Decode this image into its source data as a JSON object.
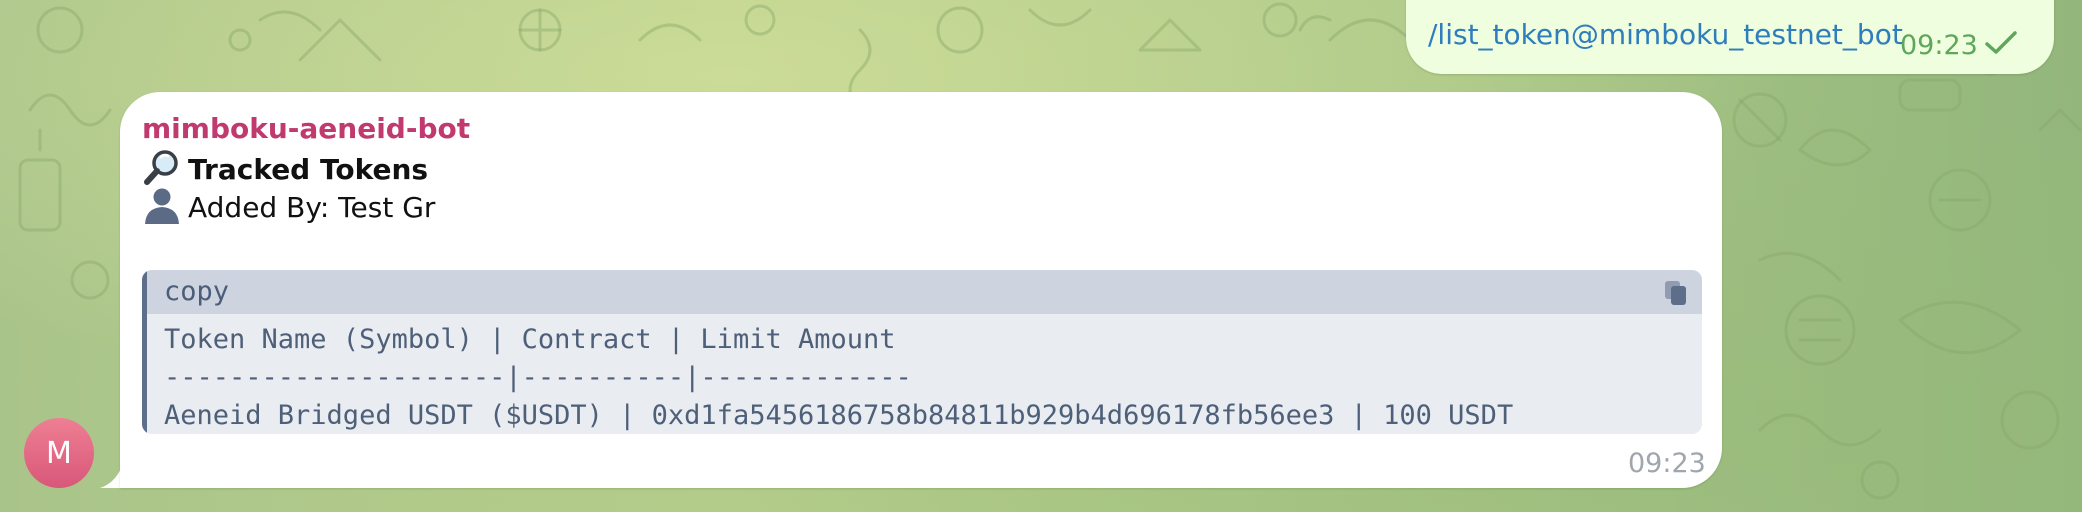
{
  "outgoing_message": {
    "text": "/list_token@mimboku_testnet_bot",
    "time": "09:23",
    "status_icon": "check-icon"
  },
  "incoming_message": {
    "sender": "mimboku-aeneid-bot",
    "title_icon": "magnifier-icon",
    "title": "Tracked Tokens",
    "added_by_icon": "user-silhouette-icon",
    "added_by": "Added By: Test Gr",
    "code_block": {
      "language": "copy",
      "copy_icon": "copy-icon",
      "lines": [
        "Token Name (Symbol) | Contract | Limit Amount",
        "---------------------|----------|-------------",
        "Aeneid Bridged USDT ($USDT) | 0xd1fa5456186758b84811b929b4d696178fb56ee3 | 100 USDT"
      ]
    },
    "time": "09:23"
  },
  "avatar": {
    "initial": "M"
  },
  "colors": {
    "sender_name": "#c13a6f",
    "link": "#2f7dbd",
    "outgoing_bubble": "#eefedf",
    "outgoing_meta": "#5fa65a",
    "code_background": "#e9ecf0",
    "code_header": "#cdd4df",
    "avatar": "#e06a86"
  }
}
